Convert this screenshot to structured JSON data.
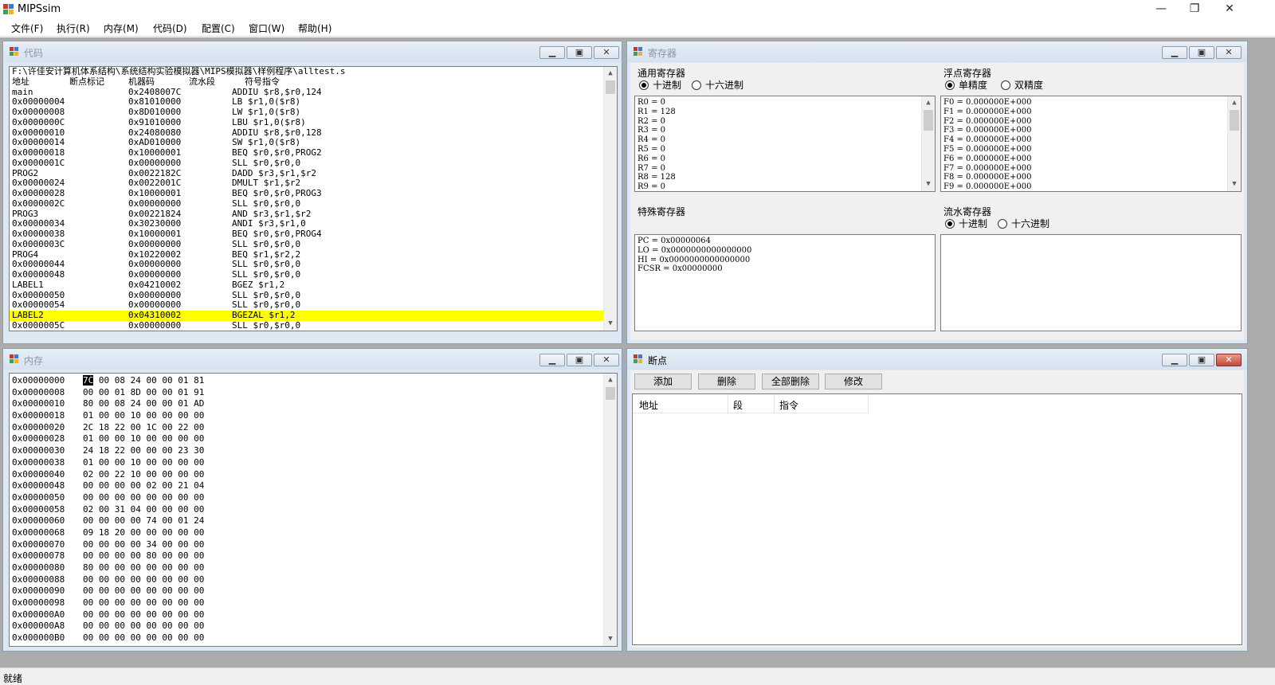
{
  "app": {
    "title": "MIPSsim"
  },
  "window_controls": {
    "minimize": "—",
    "maximize": "❐",
    "close": "✕"
  },
  "menu": [
    "文件(F)",
    "执行(R)",
    "内存(M)",
    "代码(D)",
    "配置(C)",
    "窗口(W)",
    "帮助(H)"
  ],
  "code_window": {
    "title": "代码",
    "path": "F:\\许佳安计算机体系结构\\系统结构实验模拟器\\MIPS模拟器\\样例程序\\alltest.s",
    "headers": [
      "地址",
      "断点标记",
      "机器码",
      "流水段",
      "符号指令"
    ],
    "rows": [
      [
        "main",
        "0x2408007C",
        "ADDIU $r8,$r0,124"
      ],
      [
        "0x00000004",
        "0x81010000",
        "LB $r1,0($r8)"
      ],
      [
        "0x00000008",
        "0x8D010000",
        "LW $r1,0($r8)"
      ],
      [
        "0x0000000C",
        "0x91010000",
        "LBU $r1,0($r8)"
      ],
      [
        "0x00000010",
        "0x24080080",
        "ADDIU $r8,$r0,128"
      ],
      [
        "0x00000014",
        "0xAD010000",
        "SW $r1,0($r8)"
      ],
      [
        "0x00000018",
        "0x10000001",
        "BEQ $r0,$r0,PROG2"
      ],
      [
        "0x0000001C",
        "0x00000000",
        "SLL $r0,$r0,0"
      ],
      [
        "PROG2",
        "0x0022182C",
        "DADD $r3,$r1,$r2"
      ],
      [
        "0x00000024",
        "0x0022001C",
        "DMULT $r1,$r2"
      ],
      [
        "0x00000028",
        "0x10000001",
        "BEQ $r0,$r0,PROG3"
      ],
      [
        "0x0000002C",
        "0x00000000",
        "SLL $r0,$r0,0"
      ],
      [
        "PROG3",
        "0x00221824",
        "AND $r3,$r1,$r2"
      ],
      [
        "0x00000034",
        "0x30230000",
        "ANDI $r3,$r1,0"
      ],
      [
        "0x00000038",
        "0x10000001",
        "BEQ $r0,$r0,PROG4"
      ],
      [
        "0x0000003C",
        "0x00000000",
        "SLL $r0,$r0,0"
      ],
      [
        "PROG4",
        "0x10220002",
        "BEQ $r1,$r2,2"
      ],
      [
        "0x00000044",
        "0x00000000",
        "SLL $r0,$r0,0"
      ],
      [
        "0x00000048",
        "0x00000000",
        "SLL $r0,$r0,0"
      ],
      [
        "LABEL1",
        "0x04210002",
        "BGEZ $r1,2"
      ],
      [
        "0x00000050",
        "0x00000000",
        "SLL $r0,$r0,0"
      ],
      [
        "0x00000054",
        "0x00000000",
        "SLL $r0,$r0,0"
      ],
      [
        "LABEL2",
        "0x04310002",
        "BGEZAL $r1,2"
      ],
      [
        "0x0000005C",
        "0x00000000",
        "SLL $r0,$r0,0"
      ]
    ],
    "highlight_row": 22
  },
  "register_window": {
    "title": "寄存器",
    "general": {
      "label": "通用寄存器",
      "options": [
        "十进制",
        "十六进制"
      ],
      "selected": 0,
      "values": [
        "R0 = 0",
        "R1 = 128",
        "R2 = 0",
        "R3 = 0",
        "R4 = 0",
        "R5 = 0",
        "R6 = 0",
        "R7 = 0",
        "R8 = 128",
        "R9 = 0"
      ]
    },
    "float": {
      "label": "浮点寄存器",
      "options": [
        "单精度",
        "双精度"
      ],
      "selected": 0,
      "values": [
        "F0 = 0.000000E+000",
        "F1 = 0.000000E+000",
        "F2 = 0.000000E+000",
        "F3 = 0.000000E+000",
        "F4 = 0.000000E+000",
        "F5 = 0.000000E+000",
        "F6 = 0.000000E+000",
        "F7 = 0.000000E+000",
        "F8 = 0.000000E+000",
        "F9 = 0.000000E+000"
      ]
    },
    "special": {
      "label": "特殊寄存器",
      "values": [
        "PC = 0x00000064",
        "LO = 0x0000000000000000",
        "HI = 0x0000000000000000",
        "FCSR = 0x00000000"
      ]
    },
    "pipeline": {
      "label": "流水寄存器",
      "options": [
        "十进制",
        "十六进制"
      ],
      "selected": 0
    }
  },
  "memory_window": {
    "title": "内存",
    "rows": [
      [
        "0x00000000",
        "7C 00 08 24 00 00 01 81"
      ],
      [
        "0x00000008",
        "00 00 01 8D 00 00 01 91"
      ],
      [
        "0x00000010",
        "80 00 08 24 00 00 01 AD"
      ],
      [
        "0x00000018",
        "01 00 00 10 00 00 00 00"
      ],
      [
        "0x00000020",
        "2C 18 22 00 1C 00 22 00"
      ],
      [
        "0x00000028",
        "01 00 00 10 00 00 00 00"
      ],
      [
        "0x00000030",
        "24 18 22 00 00 00 23 30"
      ],
      [
        "0x00000038",
        "01 00 00 10 00 00 00 00"
      ],
      [
        "0x00000040",
        "02 00 22 10 00 00 00 00"
      ],
      [
        "0x00000048",
        "00 00 00 00 02 00 21 04"
      ],
      [
        "0x00000050",
        "00 00 00 00 00 00 00 00"
      ],
      [
        "0x00000058",
        "02 00 31 04 00 00 00 00"
      ],
      [
        "0x00000060",
        "00 00 00 00 74 00 01 24"
      ],
      [
        "0x00000068",
        "09 18 20 00 00 00 00 00"
      ],
      [
        "0x00000070",
        "00 00 00 00 34 00 00 00"
      ],
      [
        "0x00000078",
        "00 00 00 00 80 00 00 00"
      ],
      [
        "0x00000080",
        "80 00 00 00 00 00 00 00"
      ],
      [
        "0x00000088",
        "00 00 00 00 00 00 00 00"
      ],
      [
        "0x00000090",
        "00 00 00 00 00 00 00 00"
      ],
      [
        "0x00000098",
        "00 00 00 00 00 00 00 00"
      ],
      [
        "0x000000A0",
        "00 00 00 00 00 00 00 00"
      ],
      [
        "0x000000A8",
        "00 00 00 00 00 00 00 00"
      ],
      [
        "0x000000B0",
        "00 00 00 00 00 00 00 00"
      ]
    ]
  },
  "breakpoint_window": {
    "title": "断点",
    "buttons": [
      "添加",
      "删除",
      "全部删除",
      "修改"
    ],
    "headers": [
      "地址",
      "段",
      "指令"
    ]
  },
  "status": {
    "text": "就绪"
  },
  "icon_names": [
    "app-icon",
    "window-icon",
    "minimize-icon",
    "restore-icon",
    "close-icon",
    "scroll-up-icon",
    "scroll-down-icon"
  ]
}
